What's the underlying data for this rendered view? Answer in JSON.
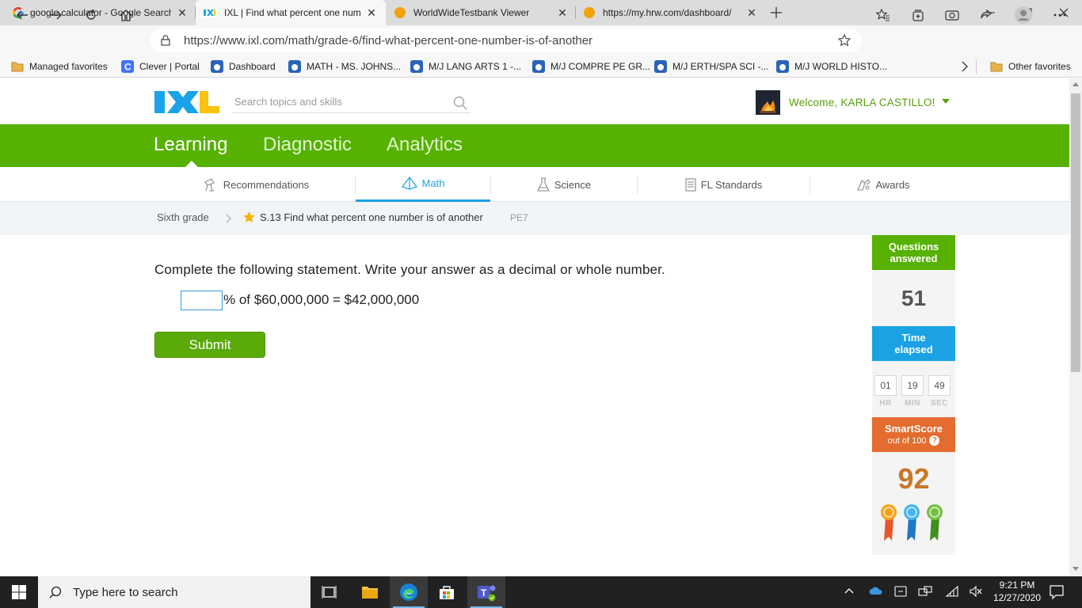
{
  "browser": {
    "tabs": [
      {
        "title": "google calculator - Google Search",
        "active": false
      },
      {
        "title": "IXL | Find what percent one number is of another",
        "active": true
      },
      {
        "title": "WorldWideTestbank Viewer",
        "active": false
      },
      {
        "title": "https://my.hrw.com/dashboard/",
        "active": false
      }
    ],
    "url": "https://www.ixl.com/math/grade-6/find-what-percent-one-number-is-of-another",
    "favorites": [
      "Managed favorites",
      "Clever | Portal",
      "Dashboard",
      "MATH - MS. JOHNS...",
      "M/J LANG ARTS 1 -...",
      "M/J COMPRE PE GR...",
      "M/J ERTH/SPA SCI -...",
      "M/J WORLD HISTO...",
      "Other favorites"
    ]
  },
  "ixl": {
    "logo": "IXL",
    "search_placeholder": "Search topics and skills",
    "welcome": "Welcome, KARLA CASTILLO!",
    "main_nav": [
      "Learning",
      "Diagnostic",
      "Analytics"
    ],
    "sub_nav": [
      "Recommendations",
      "Math",
      "Science",
      "FL Standards",
      "Awards"
    ],
    "breadcrumb": {
      "grade": "Sixth grade",
      "skill": "S.13 Find what percent one number is of another",
      "code": "PE7"
    },
    "question": {
      "prompt": "Complete the following statement. Write your answer as a decimal or whole number.",
      "answer_value": "",
      "equation_suffix": "% of $60,000,000 = $42,000,000"
    },
    "submit_label": "Submit",
    "stats": {
      "questions_answered_label": "Questions answered",
      "questions_answered": "51",
      "time_elapsed_label": "Time elapsed",
      "hr": "01",
      "min": "19",
      "sec": "49",
      "hr_label": "HR",
      "min_label": "MIN",
      "sec_label": "SEC",
      "smartscore_label": "SmartScore",
      "smartscore_sub": "out of 100",
      "smartscore": "92",
      "help": "?"
    },
    "colors": {
      "green": "#56b100",
      "blue": "#1ba2e4",
      "orange": "#e46c2e",
      "score": "#c8782a"
    }
  },
  "taskbar": {
    "search_placeholder": "Type here to search",
    "time": "9:21 PM",
    "date": "12/27/2020"
  }
}
